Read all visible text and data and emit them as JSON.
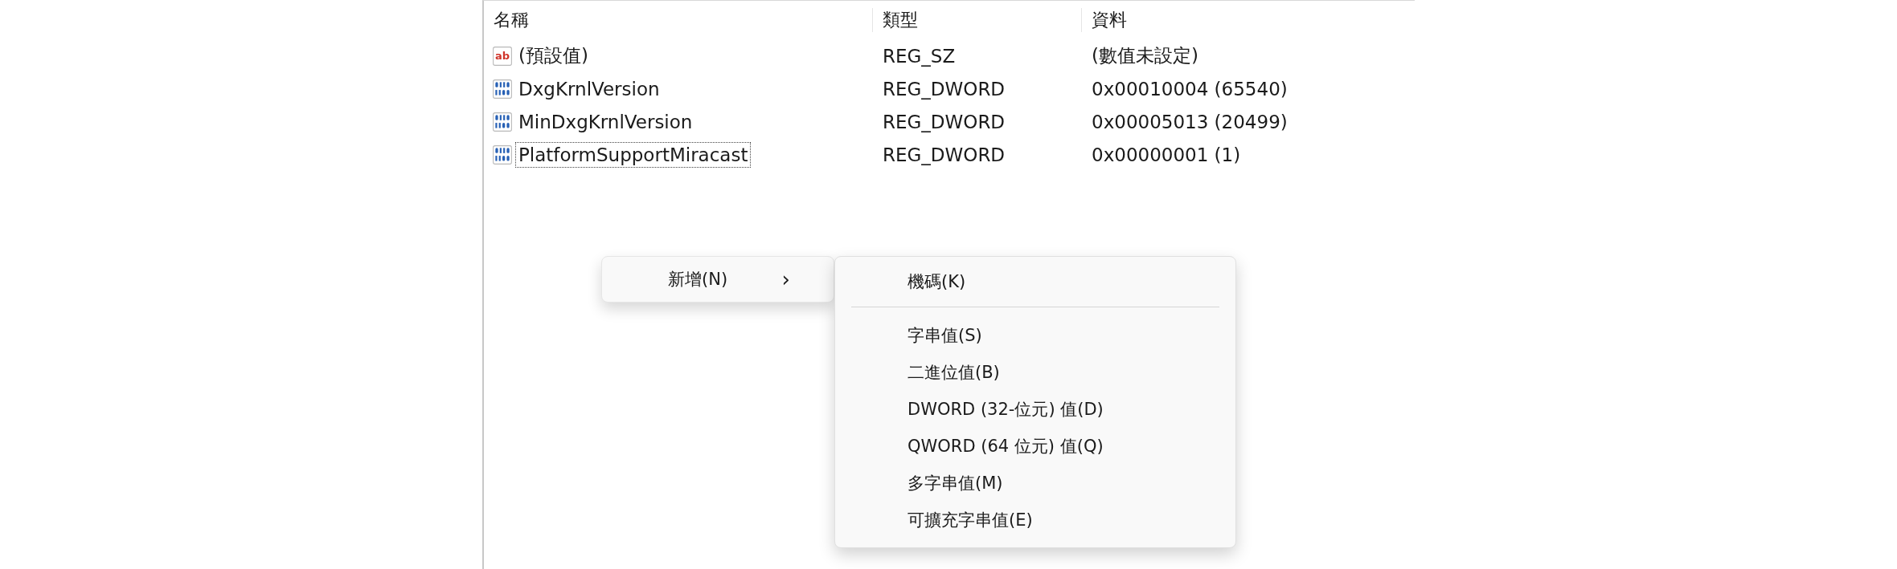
{
  "table": {
    "columns": [
      "名稱",
      "類型",
      "資料"
    ],
    "rows": [
      {
        "kind": "string",
        "icon_label": "ab",
        "name": "(預設值)",
        "type": "REG_SZ",
        "data": "(數值未設定)",
        "focused": false
      },
      {
        "kind": "binary",
        "name": "DxgKrnlVersion",
        "type": "REG_DWORD",
        "data": "0x00010004 (65540)",
        "focused": false
      },
      {
        "kind": "binary",
        "name": "MinDxgKrnlVersion",
        "type": "REG_DWORD",
        "data": "0x00005013 (20499)",
        "focused": false
      },
      {
        "kind": "binary",
        "name": "PlatformSupportMiracast",
        "type": "REG_DWORD",
        "data": "0x00000001 (1)",
        "focused": true
      }
    ]
  },
  "context_menu": {
    "items": [
      {
        "label": "新增(N)",
        "submenu_arrow": "›"
      }
    ]
  },
  "submenu": {
    "items": [
      {
        "kind": "item",
        "label": "機碼(K)"
      },
      {
        "kind": "separator"
      },
      {
        "kind": "item",
        "label": "字串值(S)"
      },
      {
        "kind": "item",
        "label": "二進位值(B)"
      },
      {
        "kind": "item",
        "label": "DWORD (32-位元) 值(D)"
      },
      {
        "kind": "item",
        "label": "QWORD (64 位元) 值(Q)"
      },
      {
        "kind": "item",
        "label": "多字串值(M)"
      },
      {
        "kind": "item",
        "label": "可擴充字串值(E)"
      }
    ]
  }
}
